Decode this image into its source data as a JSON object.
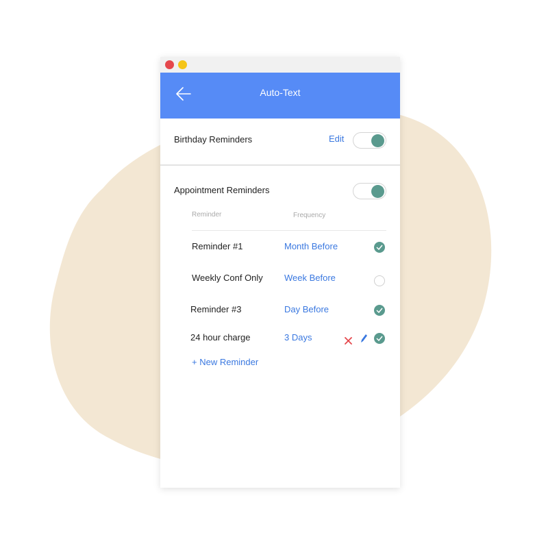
{
  "app": {
    "title": "Auto-Text"
  },
  "birthday": {
    "label": "Birthday Reminders",
    "edit_label": "Edit",
    "enabled": true
  },
  "appointment": {
    "label": "Appointment Reminders",
    "enabled": true,
    "columns": {
      "reminder": "Reminder",
      "frequency": "Frequency"
    },
    "reminders": [
      {
        "name": "Reminder #1",
        "frequency": "Month Before",
        "active": true
      },
      {
        "name": "Weekly Conf Only",
        "frequency": "Week Before",
        "active": false
      },
      {
        "name": "Reminder #3",
        "frequency": "Day Before",
        "active": true
      },
      {
        "name": "24 hour charge",
        "frequency": "3 Days",
        "active": true
      }
    ],
    "new_reminder_label": "+ New Reminder"
  },
  "colors": {
    "header": "#568bf6",
    "link": "#3a78e0",
    "toggle_on": "#5a9a8e",
    "delete": "#e5484d",
    "blob": "#f3e7d3"
  },
  "icons": {
    "back": "arrow-left-icon",
    "delete": "close-icon",
    "edit": "pencil-icon",
    "check": "checkmark-icon"
  }
}
